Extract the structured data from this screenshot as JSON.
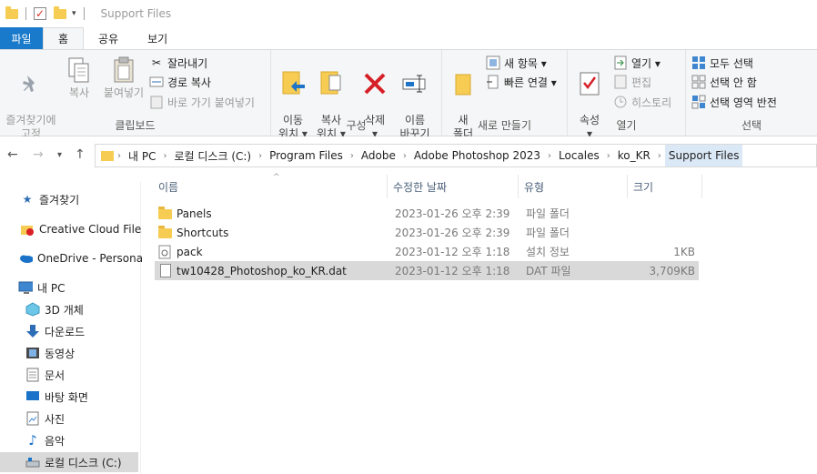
{
  "window": {
    "title": "Support Files"
  },
  "tabs": [
    {
      "label": "파일"
    },
    {
      "label": "홈"
    },
    {
      "label": "공유"
    },
    {
      "label": "보기"
    }
  ],
  "ribbon": {
    "clipboard": {
      "label": "클립보드",
      "pin": "즐겨찾기에\n고정",
      "copy": "복사",
      "paste": "붙여넣기",
      "cut": "잘라내기",
      "copy_path": "경로 복사",
      "paste_shortcut": "바로 가기 붙여넣기"
    },
    "organize": {
      "label": "구성",
      "move_to": "이동\n위치 ▾",
      "copy_to": "복사\n위치 ▾",
      "delete": "삭제\n▾",
      "rename": "이름\n바꾸기"
    },
    "new": {
      "label": "새로 만들기",
      "new_folder": "새\n폴더",
      "new_item": "새 항목 ▾",
      "easy_access": "빠른 연결 ▾"
    },
    "open": {
      "label": "열기",
      "properties": "속성\n▾",
      "open": "열기 ▾",
      "edit": "편집",
      "history": "히스토리"
    },
    "select": {
      "label": "선택",
      "select_all": "모두 선택",
      "select_none": "선택 안 함",
      "invert": "선택 영역 반전"
    }
  },
  "address": {
    "crumbs": [
      "내 PC",
      "로컬 디스크 (C:)",
      "Program Files",
      "Adobe",
      "Adobe Photoshop 2023",
      "Locales",
      "ko_KR",
      "Support Files"
    ]
  },
  "sidebar": {
    "items": [
      {
        "label": "즐겨찾기",
        "icon": "star-icon"
      },
      {
        "label": "Creative Cloud Files",
        "icon": "creative-cloud-icon"
      },
      {
        "label": "OneDrive - Personal",
        "icon": "onedrive-icon"
      },
      {
        "label": "내 PC",
        "icon": "pc-icon"
      },
      {
        "label": "3D 개체",
        "icon": "3d-objects-icon"
      },
      {
        "label": "다운로드",
        "icon": "download-icon"
      },
      {
        "label": "동영상",
        "icon": "video-icon"
      },
      {
        "label": "문서",
        "icon": "document-icon"
      },
      {
        "label": "바탕 화면",
        "icon": "desktop-icon"
      },
      {
        "label": "사진",
        "icon": "pictures-icon"
      },
      {
        "label": "음악",
        "icon": "music-icon"
      },
      {
        "label": "로컬 디스크 (C:)",
        "icon": "drive-icon"
      }
    ]
  },
  "columns": {
    "name": "이름",
    "date": "수정한 날짜",
    "type": "유형",
    "size": "크기"
  },
  "files": [
    {
      "name": "Panels",
      "date": "2023-01-26 오후 2:39",
      "type": "파일 폴더",
      "size": "",
      "icon": "folder-icon"
    },
    {
      "name": "Shortcuts",
      "date": "2023-01-26 오후 2:39",
      "type": "파일 폴더",
      "size": "",
      "icon": "folder-icon"
    },
    {
      "name": "pack",
      "date": "2023-01-12 오후 1:18",
      "type": "설치 정보",
      "size": "1KB",
      "icon": "settings-file-icon"
    },
    {
      "name": "tw10428_Photoshop_ko_KR.dat",
      "date": "2023-01-12 오후 1:18",
      "type": "DAT 파일",
      "size": "3,709KB",
      "icon": "file-icon"
    }
  ]
}
